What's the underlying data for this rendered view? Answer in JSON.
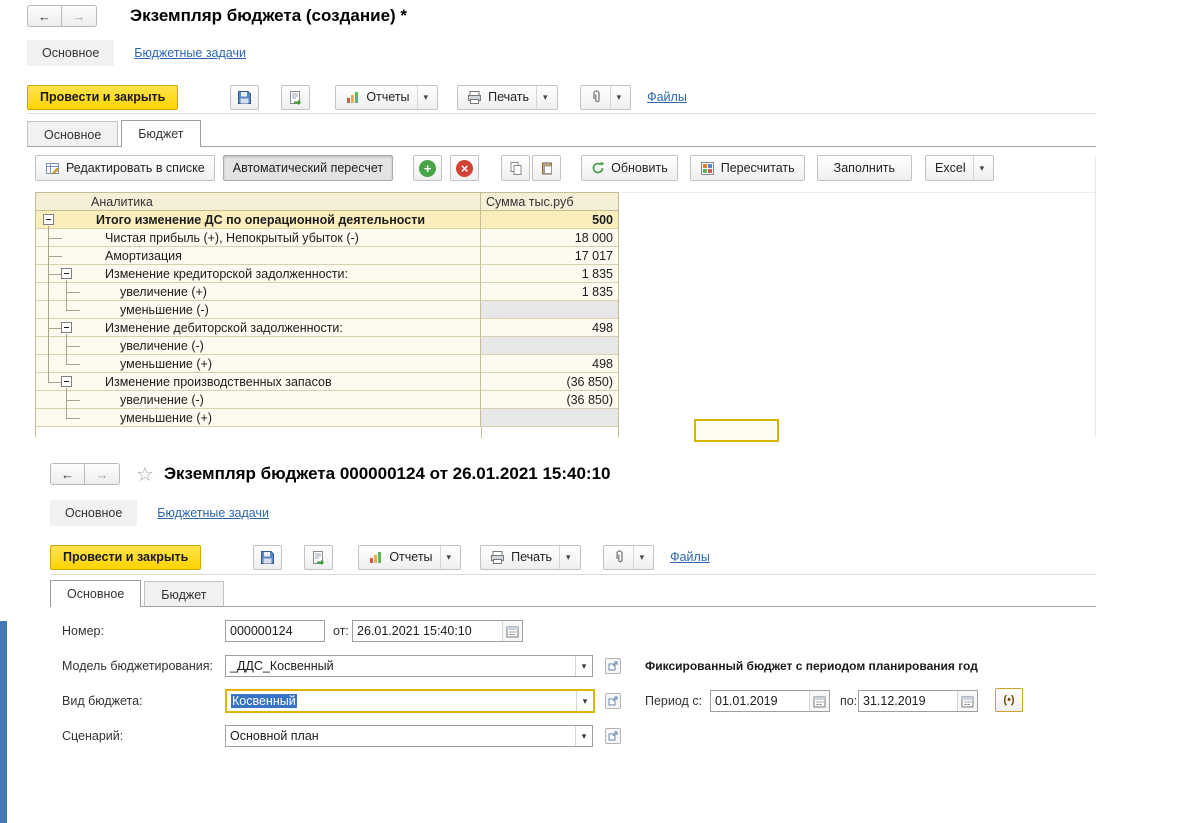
{
  "top_window": {
    "title": "Экземпляр бюджета (создание) *",
    "section_tabs": {
      "main": "Основное",
      "tasks": "Бюджетные задачи"
    },
    "toolbar": {
      "post_and_close": "Провести и закрыть",
      "reports": "Отчеты",
      "print": "Печать",
      "files": "Файлы"
    },
    "page_tabs": {
      "main": "Основное",
      "budget": "Бюджет"
    },
    "table_toolbar": {
      "edit_in_list": "Редактировать в списке",
      "auto_recalc": "Автоматический пересчет",
      "refresh": "Обновить",
      "recalc": "Пересчитать",
      "fill": "Заполнить",
      "excel": "Excel"
    },
    "table": {
      "columns": {
        "analytics": "Аналитика",
        "sum": "Сумма тыс.руб"
      },
      "rows": [
        {
          "label": "Итого изменение ДС по операционной деятельности",
          "value": "500"
        },
        {
          "label": "Чистая прибыль (+), Непокрытый убыток (-)",
          "value": "18 000"
        },
        {
          "label": "Амортизация",
          "value": "17 017"
        },
        {
          "label": "Изменение кредиторской задолженности:",
          "value": "1 835"
        },
        {
          "label": "увеличение (+)",
          "value": "1 835"
        },
        {
          "label": "уменьшение (-)",
          "value": ""
        },
        {
          "label": "Изменение дебиторской задолженности:",
          "value": "498"
        },
        {
          "label": "увеличение (-)",
          "value": ""
        },
        {
          "label": "уменьшение (+)",
          "value": "498"
        },
        {
          "label": "Изменение производственных запасов",
          "value": "(36 850)"
        },
        {
          "label": "увеличение (-)",
          "value": "(36 850)"
        },
        {
          "label": "уменьшение (+)",
          "value": ""
        }
      ]
    }
  },
  "bottom_window": {
    "title": "Экземпляр бюджета 000000124 от 26.01.2021 15:40:10",
    "section_tabs": {
      "main": "Основное",
      "tasks": "Бюджетные задачи"
    },
    "toolbar": {
      "post_and_close": "Провести и закрыть",
      "reports": "Отчеты",
      "print": "Печать",
      "files": "Файлы"
    },
    "page_tabs": {
      "main": "Основное",
      "budget": "Бюджет"
    },
    "form": {
      "number": {
        "label": "Номер:",
        "value": "000000124"
      },
      "date": {
        "label": "от:",
        "value": "26.01.2021 15:40:10"
      },
      "model": {
        "label": "Модель бюджетирования:",
        "value": "_ДДС_Косвенный",
        "note": "Фиксированный бюджет с периодом планирования год"
      },
      "kind": {
        "label": "Вид бюджета:",
        "value": "Косвенный"
      },
      "period": {
        "from_label": "Период с:",
        "from": "01.01.2019",
        "to_label": "по:",
        "to": "31.12.2019"
      },
      "scenario": {
        "label": "Сценарий:",
        "value": "Основной план"
      }
    }
  },
  "colors": {
    "accent_yellow": "#ffd300",
    "link_blue": "#2e66ad",
    "selection_blue": "#3973c5",
    "table_highlight": "#fbeebd",
    "focus_border": "#dfb700"
  }
}
